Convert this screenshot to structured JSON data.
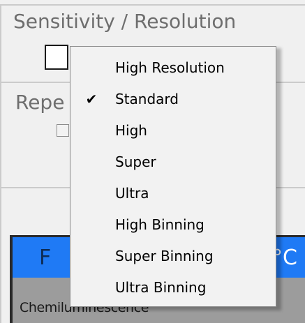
{
  "sensitivity": {
    "title": "Sensitivity / Resolution",
    "dropdown": {
      "selected": "Standard",
      "options": [
        {
          "label": "High Resolution",
          "checked": false
        },
        {
          "label": "Standard",
          "checked": true
        },
        {
          "label": "High",
          "checked": false
        },
        {
          "label": "Super",
          "checked": false
        },
        {
          "label": "Ultra",
          "checked": false
        },
        {
          "label": "High Binning",
          "checked": false
        },
        {
          "label": "Super Binning",
          "checked": false
        },
        {
          "label": "Ultra Binning",
          "checked": false
        }
      ],
      "check_glyph": "✔"
    }
  },
  "repeat": {
    "label_visible": "Repe",
    "checked": false
  },
  "panel": {
    "header_left": "F",
    "header_right": "°C",
    "body_text": "Chemiluminescence",
    "header_color": "#1f7af5"
  }
}
